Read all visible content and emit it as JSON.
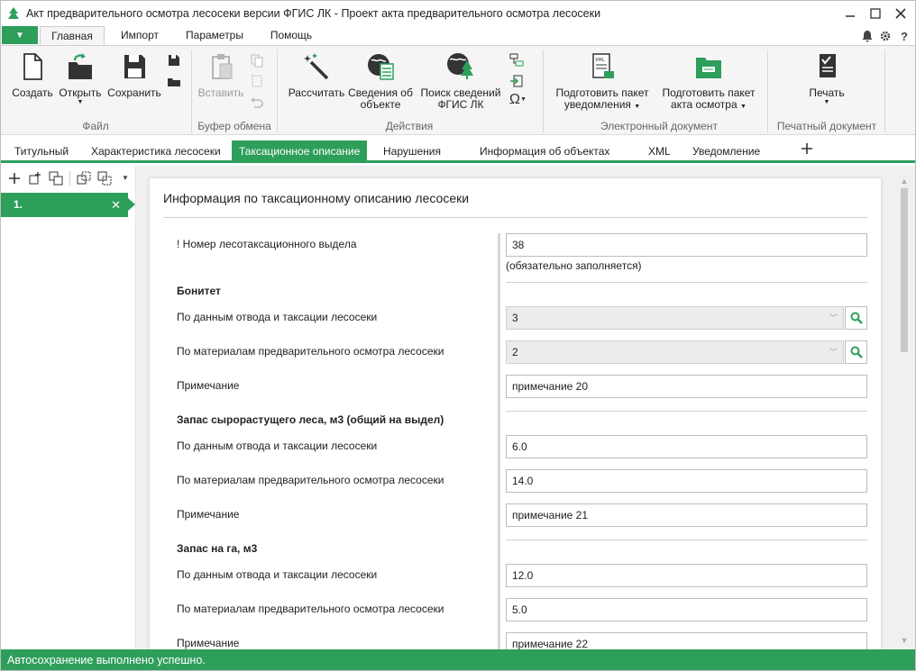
{
  "window": {
    "title": "Акт предварительного осмотра лесосеки версии ФГИС ЛК - Проект акта предварительного осмотра лесосеки"
  },
  "ribbon_tabs": [
    "Главная",
    "Импорт",
    "Параметры",
    "Помощь"
  ],
  "ribbon": {
    "file": {
      "create": "Создать",
      "open": "Открыть",
      "save": "Сохранить",
      "group": "Файл"
    },
    "clipboard": {
      "paste": "Вставить",
      "group": "Буфер обмена"
    },
    "actions": {
      "calc": "Рассчитать",
      "info_l1": "Сведения об",
      "info_l2": "объекте",
      "search_l1": "Поиск сведений",
      "search_l2": "ФГИС ЛК",
      "group": "Действия"
    },
    "edoc": {
      "notif_l1": "Подготовить пакет",
      "notif_l2": "уведомления",
      "act_l1": "Подготовить пакет",
      "act_l2": "акта осмотра",
      "group": "Электронный документ"
    },
    "print": {
      "print": "Печать",
      "group": "Печатный документ"
    }
  },
  "doc_tabs": [
    "Титульный",
    "Характеристика лесосеки",
    "Таксационное описание",
    "Нарушения",
    "Информация об объектах",
    "XML",
    "Уведомление"
  ],
  "left_panel": {
    "item": "1."
  },
  "form": {
    "title": "Информация по таксационному описанию лесосеки",
    "vydel_label": "! Номер лесотаксационного выдела",
    "vydel_value": "38",
    "vydel_hint": "(обязательно заполняется)",
    "bonitet_header": "Бонитет",
    "bonitet_otvod_label": "По данным отвода и таксации лесосеки",
    "bonitet_otvod_value": "3",
    "bonitet_osmotr_label": "По материалам предварительного осмотра лесосеки",
    "bonitet_osmotr_value": "2",
    "bonitet_note_label": "Примечание",
    "bonitet_note_value": "примечание 20",
    "zapas_header": "Запас сырорастущего леса, м3 (общий на выдел)",
    "zapas_otvod_label": "По данным отвода и таксации лесосеки",
    "zapas_otvod_value": "6.0",
    "zapas_osmotr_label": "По материалам предварительного осмотра лесосеки",
    "zapas_osmotr_value": "14.0",
    "zapas_note_label": "Примечание",
    "zapas_note_value": "примечание 21",
    "zapasga_header": "Запас на га, м3",
    "zapasga_otvod_label": "По данным отвода и таксации лесосеки",
    "zapasga_otvod_value": "12.0",
    "zapasga_osmotr_label": "По материалам предварительного осмотра лесосеки",
    "zapasga_osmotr_value": "5.0",
    "zapasga_note_label": "Примечание",
    "zapasga_note_value": "примечание 22"
  },
  "status": "Автосохранение выполнено успешно.",
  "colors": {
    "accent": "#2e9e5b"
  }
}
